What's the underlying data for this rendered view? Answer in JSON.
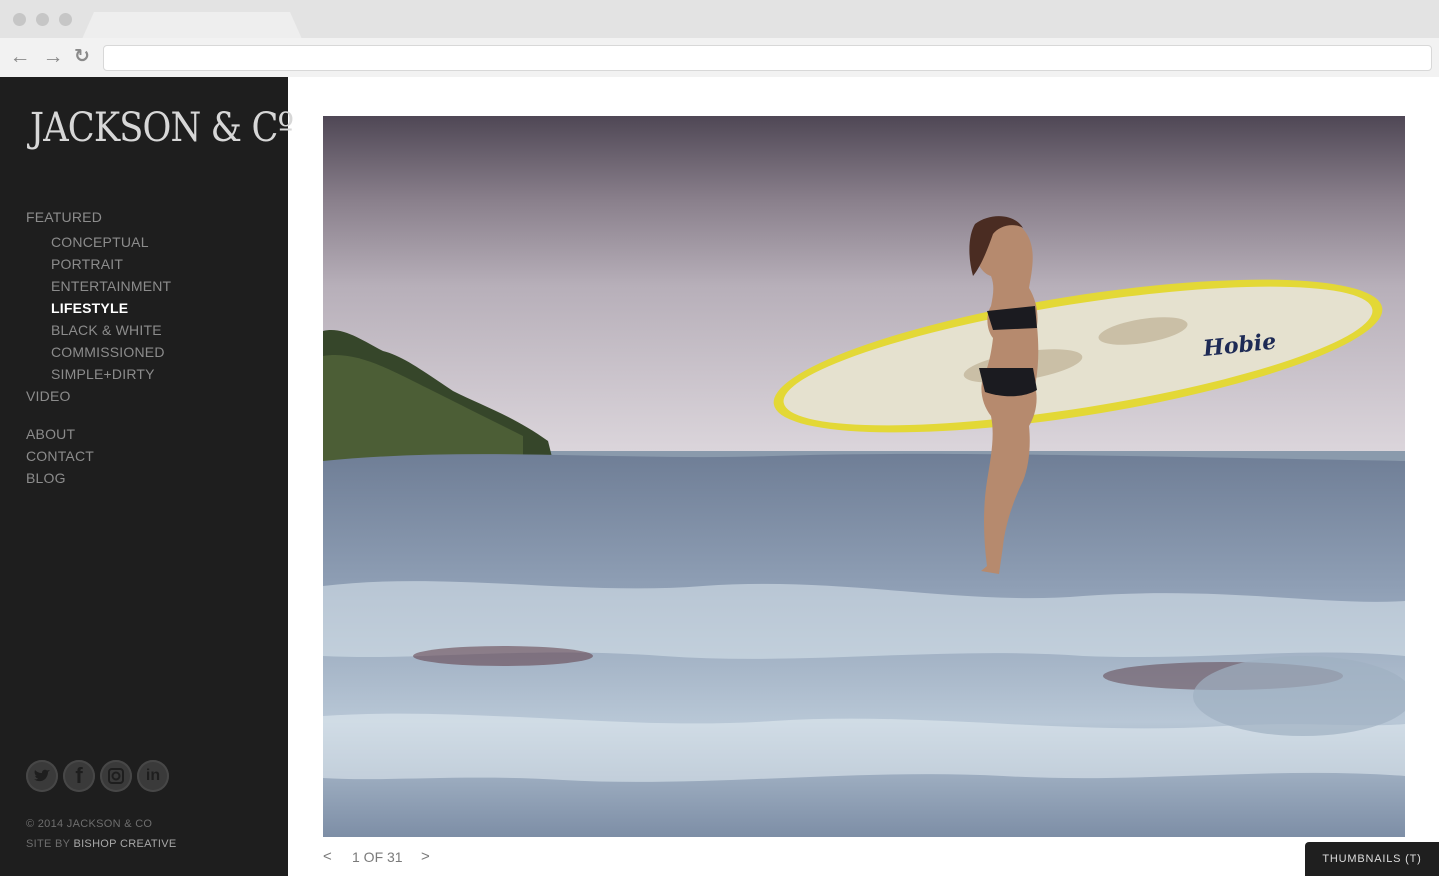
{
  "browser": {
    "back_icon": "arrow-left-icon",
    "forward_icon": "arrow-right-icon",
    "reload_icon": "reload-icon"
  },
  "sidebar": {
    "logo": "JACKSON & Cº",
    "menu": {
      "featured": "FEATURED",
      "sub": [
        "CONCEPTUAL",
        "PORTRAIT",
        "ENTERTAINMENT",
        "LIFESTYLE",
        "BLACK & WHITE",
        "COMMISSIONED",
        "SIMPLE+DIRTY"
      ],
      "active": "LIFESTYLE",
      "video": "VIDEO",
      "about": "ABOUT",
      "contact": "CONTACT",
      "blog": "BLOG"
    },
    "social": [
      {
        "icon": "twitter-icon"
      },
      {
        "icon": "facebook-icon",
        "glyph": "f"
      },
      {
        "icon": "instagram-icon"
      },
      {
        "icon": "linkedin-icon",
        "glyph": "in"
      }
    ],
    "copyright": "© 2014 JACKSON & CO",
    "credit_prefix": "SITE BY ",
    "credit_studio": "BISHOP CREATIVE"
  },
  "gallery": {
    "prev": "<",
    "counter": "1 OF 31",
    "next": ">",
    "thumbnails_button": "THUMBNAILS (T)",
    "board_brand": "Hobie"
  },
  "colors": {
    "sidebar_bg": "#1e1e1e",
    "menu_text": "#8c8c8c",
    "active_text": "#ffffff"
  }
}
